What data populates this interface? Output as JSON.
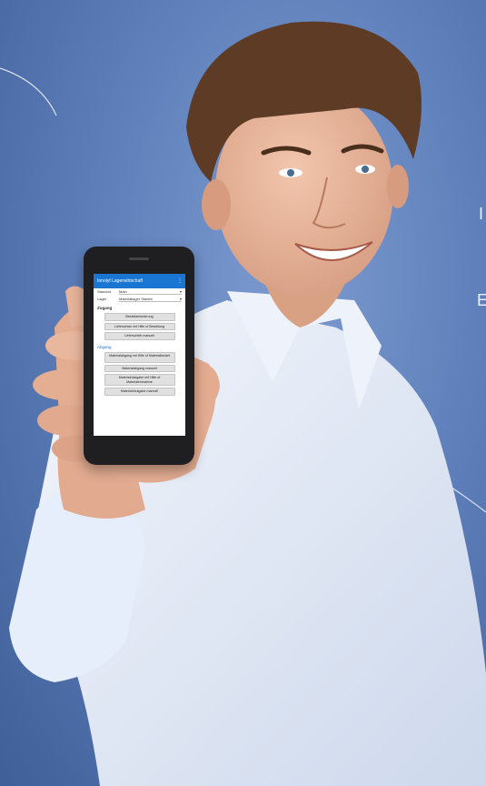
{
  "colors": {
    "background": "#5f80bb",
    "app_bar": "#1976d2",
    "shirt": "#dfe7f6",
    "skin": "#e7b49a"
  },
  "edge_text": [
    "I",
    "E"
  ],
  "phone_app": {
    "title": "Innolyt Lagerwirtschaft",
    "menu_icon": "overflow-menu-icon",
    "fields": [
      {
        "label": "Standort",
        "value": "Main"
      },
      {
        "label": "Lager",
        "value": "Materiallager Stadtm"
      }
    ],
    "sections": [
      {
        "title": "Zugang",
        "buttons": [
          "Bestellanforderung",
          "Lieferschein mit Hilfe of Bestellung",
          "Lieferschein manuell"
        ]
      },
      {
        "title": "Abgang",
        "buttons": [
          "Materialabgang mit Hilfe of Materialbedarf",
          "Materialabgang manuell",
          "Materialrückgabe mit Hilfe of Materialentnahme",
          "Materialrückgabe manuell"
        ]
      }
    ]
  }
}
